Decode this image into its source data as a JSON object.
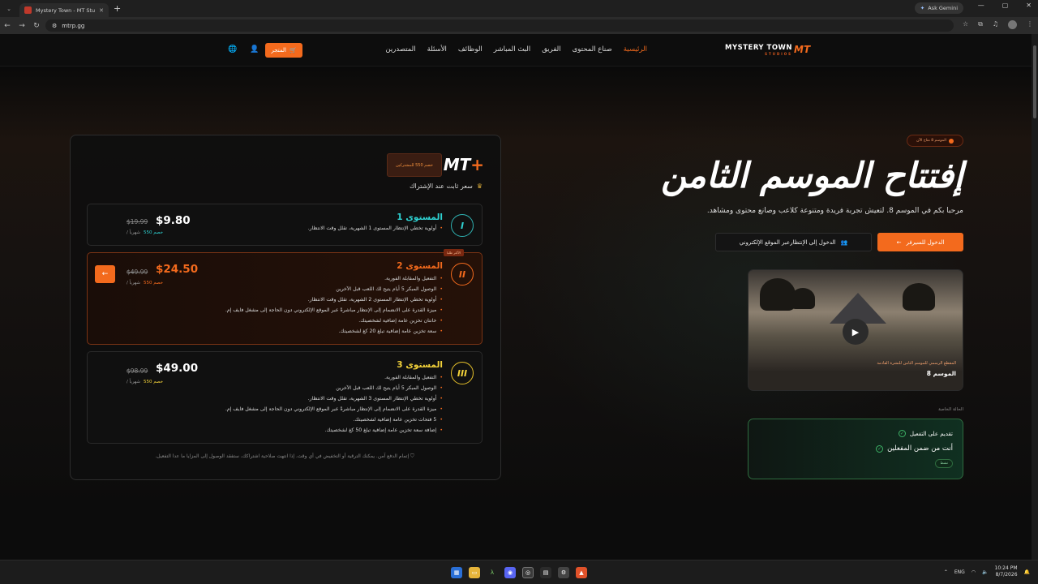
{
  "browser": {
    "tab_title": "Mystery Town - MT Studios | M",
    "new_tab": "+",
    "ask_gemini": "Ask Gemini",
    "url": "mtrp.gg"
  },
  "site": {
    "logo_main": "MYSTERY TOWN",
    "logo_sub": "STUDIOS",
    "logo_mt": "MT",
    "nav": [
      "الرئيسية",
      "صناع المحتوى",
      "الفريق",
      "البث المباشر",
      "الوظائف",
      "الأسئلة",
      "المتصدرين"
    ],
    "store": "المتجر"
  },
  "pricing": {
    "mtplus": "MT",
    "badge": "خصم 550 للمشتركين",
    "fixed_price": "سعر ثابت عند الإشتراك",
    "tiers": [
      {
        "ring": "I",
        "name": "المستوى 1",
        "price": "$9.80",
        "old": "$19.99",
        "per": "/ شهرياً",
        "discount": "خصم 550",
        "features": [
          "أولوية تخطي الإنتظار المستوى 1 الشهرية، تقلل وقت الانتظار."
        ]
      },
      {
        "ring": "II",
        "name": "المستوى 2",
        "tag": "الأكثر طلبا",
        "price": "$24.50",
        "old": "$49.99",
        "per": "/ شهرياً",
        "discount": "خصم 550",
        "features": [
          "التفعيل والمقابلة الفورية.",
          "الوصول المبكر 5 أيام يتيح لك اللعب قبل الآخرين",
          "أولوية تخطي الإنتظار المستوى 2 الشهرية، تقلل وقت الانتظار.",
          "ميزة القدرة على الانضمام إلى الإنتظار مباشرةً عبر الموقع الإلكتروني دون الحاجة إلى مشغل فايف إم.",
          "خانتان تخزين عامة إضافية لشخصيتك.",
          "سعة تخزين عامة إضافية تبلغ 20 كغ لشخصيتك."
        ]
      },
      {
        "ring": "III",
        "name": "المستوى 3",
        "price": "$49.00",
        "old": "$98.99",
        "per": "/ شهرياً",
        "discount": "خصم 550",
        "features": [
          "التفعيل والمقابلة الفورية.",
          "الوصول المبكر 5 أيام يتيح لك اللعب قبل الآخرين",
          "أولوية تخطي الإنتظار المستوى 3 الشهرية، تقلل وقت الانتظار.",
          "ميزة القدرة على الانضمام إلى الإنتظار مباشرةً عبر الموقع الإلكتروني دون الحاجة إلى مشغل فايف إم.",
          "5 فتحات تخزين عامة إضافية لشخصيتك.",
          "إضافة سعة تخزين عامة إضافية تبلغ 50 كغ لشخصيتك."
        ]
      }
    ],
    "secure": "إتمام الدفع آمن. يمكنك الترقية أو التخفيض في أي وقت. إذا انتهت صلاحية اشتراكك، ستفقد الوصول إلى المزايا ما عدا التفعيل."
  },
  "hero": {
    "tag": "الموسم 8 متاح الآن",
    "title": "إفتتاح الموسم الثامن",
    "subtitle": "مرحبا بكم في الموسم 8. لتعيش تجربة فريدة ومتنوعة كلاعب وصانع محتوى ومشاهد.",
    "btn_server": "الدخول للسيرفر",
    "btn_queue": "الدخول إلى الإنتظارعبر الموقع الإلكتروني",
    "video_caption": "المقطع الرسمي للموسم الثامن للنشرة القادمة",
    "video_title": "الموسم 8",
    "current_label": "الحالة الخاصة",
    "status_1": "تقديم على التفعيل",
    "status_2": "أنت من ضمن المفعلين",
    "active": "نشط"
  },
  "taskbar": {
    "lang": "ENG",
    "time": "10:24 PM",
    "date": "8/7/2026"
  }
}
